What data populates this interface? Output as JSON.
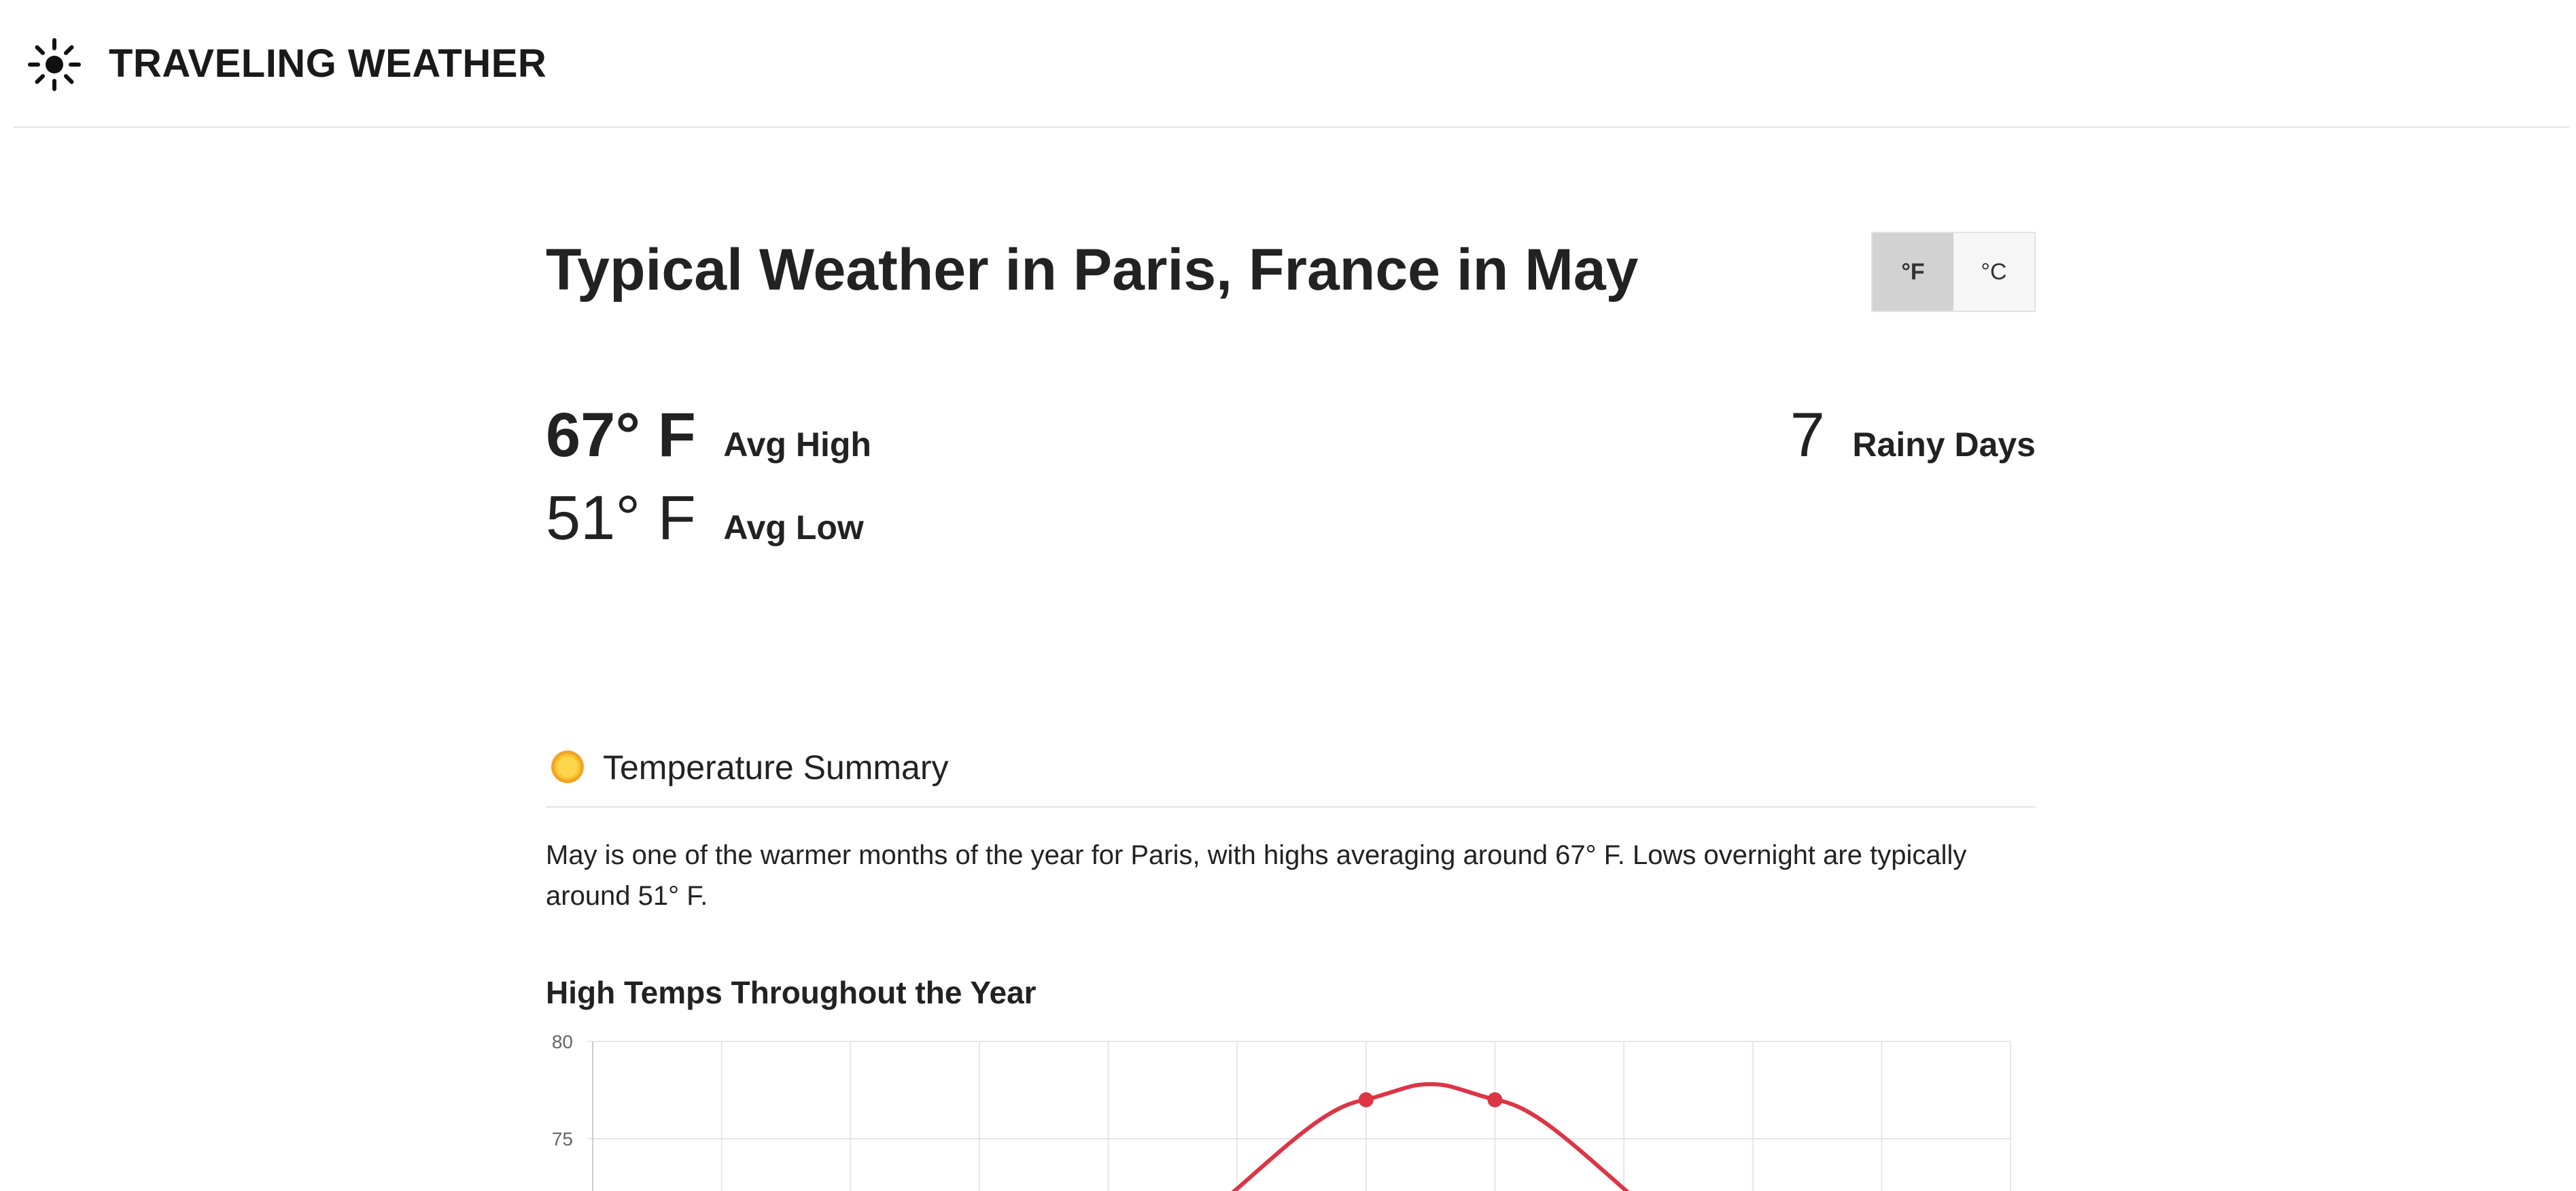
{
  "header": {
    "brand_icon": "sun-icon",
    "brand_title": "TRAVELING WEATHER"
  },
  "page": {
    "title": "Typical Weather in Paris, France in May"
  },
  "unit_toggle": {
    "fahrenheit_label": "°F",
    "celsius_label": "°C",
    "selected": "°F"
  },
  "stats": {
    "avg_high_value": "67° F",
    "avg_high_label": "Avg High",
    "avg_low_value": "51° F",
    "avg_low_label": "Avg Low",
    "rainy_days_value": "7",
    "rainy_days_label": "Rainy Days"
  },
  "temperature_summary": {
    "icon": "sun-emoji-icon",
    "title": "Temperature Summary",
    "text": "May is one of the warmer months of the year for Paris, with highs averaging around 67° F. Lows overnight are typically around 51° F."
  },
  "chart_data": {
    "type": "line",
    "title": "High Temps Throughout the Year",
    "xlabel": "",
    "ylabel": "",
    "y_tick_labels": [
      "80",
      "75"
    ],
    "ylim_visible": [
      72.7,
      80
    ],
    "grid": true,
    "series": [
      {
        "color": "#dc3545",
        "points": [
          {
            "x_index": 6,
            "y": 77
          },
          {
            "x_index": 7,
            "y": 77
          }
        ]
      }
    ],
    "visible_curve_peak": 77.8
  },
  "colors": {
    "accent_line": "#dc3545",
    "toggle_active_bg": "#d2d2d2",
    "divider": "#e2e2e2"
  }
}
